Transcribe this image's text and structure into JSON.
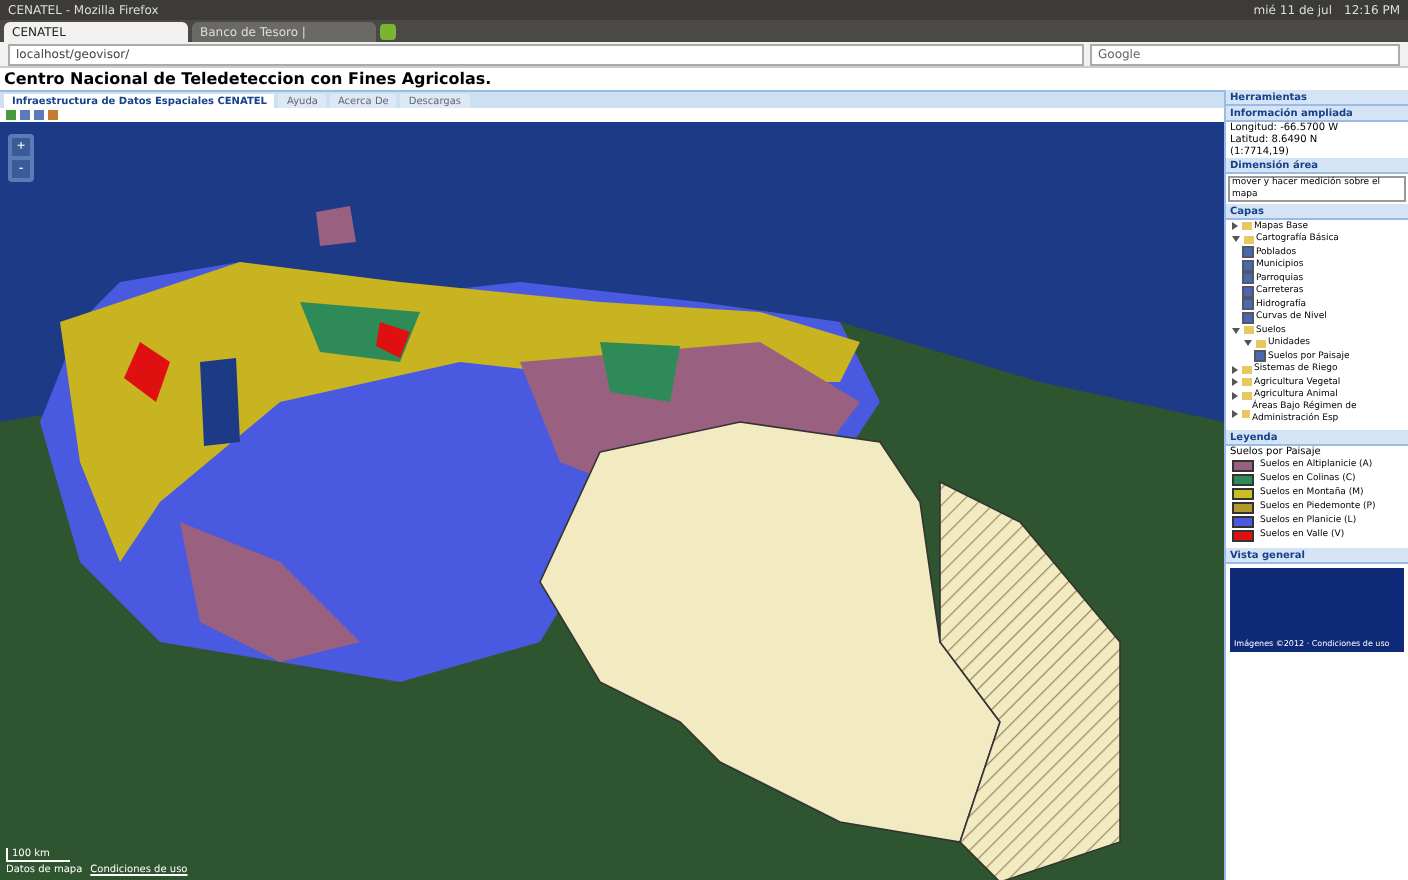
{
  "os_bar": {
    "title": "CENATEL - Mozilla Firefox",
    "date": "mié 11 de jul",
    "time": "12:16 PM"
  },
  "browser_tabs": [
    {
      "label": "CENATEL",
      "selected": true
    },
    {
      "label": "Banco de Tesoro |",
      "selected": false
    }
  ],
  "address_bar": {
    "url": "localhost/geovisor/",
    "search": "Google"
  },
  "page_title": "Centro Nacional de Teledeteccion con Fines Agricolas.",
  "app_tabs": [
    {
      "label": "Infraestructura de Datos Espaciales CENATEL",
      "selected": true
    },
    {
      "label": "Ayuda",
      "selected": false
    },
    {
      "label": "Acerca De",
      "selected": false
    },
    {
      "label": "Descargas",
      "selected": false
    }
  ],
  "map": {
    "zoom_in": "+",
    "zoom_out": "-",
    "scale": "100 km",
    "attribution": "Datos de mapa",
    "terms": "Condiciones de uso"
  },
  "side_panel": {
    "tools": {
      "title": "Herramientas"
    },
    "info": {
      "title": "Información ampliada",
      "lines": [
        "Longitud: -66.5700 W",
        "Latitud: 8.6490 N",
        "(1:7714,19)"
      ]
    },
    "measure": {
      "title": "Dimensión área",
      "value": "mover y hacer medición sobre el mapa"
    },
    "layers": {
      "title": "Capas",
      "items": [
        {
          "label": "Mapas Base",
          "expanded": false
        },
        {
          "label": "Cartografía Básica",
          "expanded": true,
          "children": [
            {
              "label": "Poblados",
              "checked": true
            },
            {
              "label": "Municipios",
              "checked": true
            },
            {
              "label": "Parroquias",
              "checked": true
            },
            {
              "label": "Carreteras",
              "checked": true
            },
            {
              "label": "Hidrografía",
              "checked": true
            },
            {
              "label": "Curvas de Nivel",
              "checked": true
            }
          ]
        },
        {
          "label": "Suelos",
          "expanded": true,
          "children": [
            {
              "label": "Unidades",
              "expanded": true,
              "children": [
                {
                  "label": "Suelos por Paisaje",
                  "checked": true
                }
              ]
            }
          ]
        },
        {
          "label": "Sistemas de Riego",
          "expanded": false
        },
        {
          "label": "Agricultura Vegetal",
          "expanded": false
        },
        {
          "label": "Agricultura Animal",
          "expanded": false
        },
        {
          "label": "Áreas Bajo Régimen de Administración Esp",
          "expanded": false
        }
      ]
    },
    "legend": {
      "title": "Leyenda",
      "subtitle": "Suelos por Paisaje",
      "items": [
        {
          "label": "Suelos en Altiplanicie (A)",
          "color": "#9a6080"
        },
        {
          "label": "Suelos en Colinas (C)",
          "color": "#2e8b57"
        },
        {
          "label": "Suelos en Montaña (M)",
          "color": "#c8c020"
        },
        {
          "label": "Suelos en Piedemonte (P)",
          "color": "#b09a30"
        },
        {
          "label": "Suelos en Planicie (L)",
          "color": "#4a5ae0"
        },
        {
          "label": "Suelos en Valle (V)",
          "color": "#e01010"
        }
      ]
    },
    "overview": {
      "title": "Vista general",
      "caption": "Imágenes ©2012 · Condiciones de uso"
    }
  }
}
